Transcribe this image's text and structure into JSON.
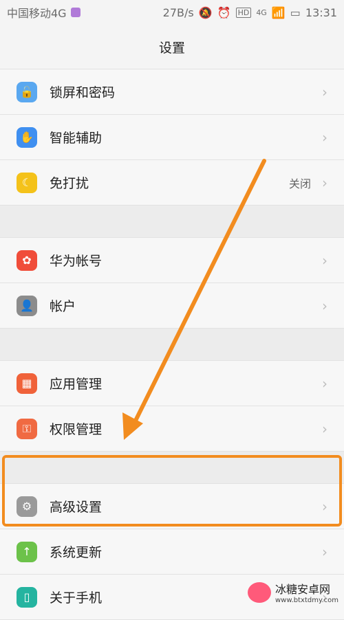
{
  "status_bar": {
    "carrier": "中国移动4G",
    "speed": "27B/s",
    "hd": "HD",
    "network": "4G",
    "time": "13:31"
  },
  "page": {
    "title": "设置"
  },
  "rows": [
    {
      "label": "锁屏和密码",
      "icon": "lock-icon",
      "color": "#5aa8f0"
    },
    {
      "label": "智能辅助",
      "icon": "hand-icon",
      "color": "#3f8ff0"
    },
    {
      "label": "免打扰",
      "icon": "moon-icon",
      "color": "#f4c21a",
      "value": "关闭"
    },
    {
      "label": "华为帐号",
      "icon": "huawei-icon",
      "color": "#f04d3a"
    },
    {
      "label": "帐户",
      "icon": "user-icon",
      "color": "#8c8c8c"
    },
    {
      "label": "应用管理",
      "icon": "apps-icon",
      "color": "#f0623a"
    },
    {
      "label": "权限管理",
      "icon": "shield-key-icon",
      "color": "#f06a42"
    },
    {
      "label": "高级设置",
      "icon": "gear-icon",
      "color": "#9a9a9a"
    },
    {
      "label": "系统更新",
      "icon": "arrow-up-icon",
      "color": "#6cc24a"
    },
    {
      "label": "关于手机",
      "icon": "phone-icon",
      "color": "#25b4a0"
    }
  ],
  "watermark": {
    "title": "冰糖安卓网",
    "sub": "www.btxtdmy.com"
  }
}
